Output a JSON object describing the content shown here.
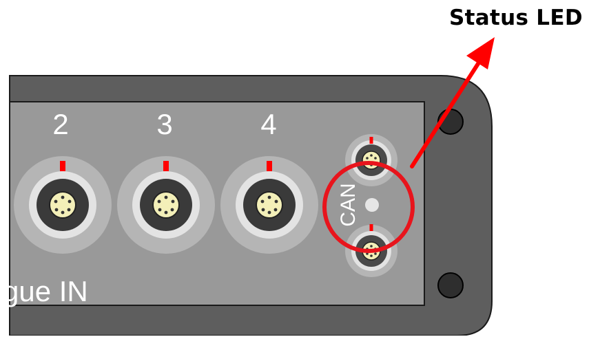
{
  "callout": {
    "label": "Status LED",
    "arrow_color": "#ff0000",
    "circle_color": "#e8141c"
  },
  "panel": {
    "label_fragment": "gue IN",
    "can_label": "CAN",
    "housing_color": "#5e5e5e",
    "faceplate_color": "#999999"
  },
  "ports": [
    {
      "number": "2"
    },
    {
      "number": "3"
    },
    {
      "number": "4"
    }
  ],
  "can_ports": [
    {
      "name": "can-port-top"
    },
    {
      "name": "can-port-bottom"
    }
  ],
  "screws": [
    {
      "name": "screw-top"
    },
    {
      "name": "screw-bottom"
    }
  ]
}
